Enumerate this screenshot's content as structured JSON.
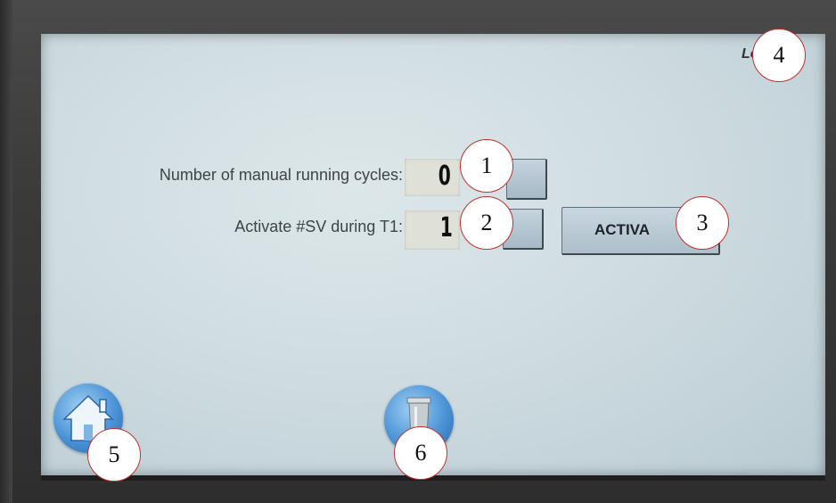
{
  "screen": {
    "corner_label": "Le",
    "rows": [
      {
        "label": "Number of manual running cycles:",
        "value": "0"
      },
      {
        "label": "Activate #SV during T1:",
        "value": "1"
      }
    ],
    "activate_label": "ACTIVA",
    "home_icon": "house-icon",
    "cup_icon": "cup-icon"
  },
  "callouts": [
    "1",
    "2",
    "3",
    "4",
    "5",
    "6"
  ],
  "colors": {
    "screen_bg": "#ccdadf",
    "button_blue": "#4b93d6",
    "callout_border": "#c0302a"
  }
}
